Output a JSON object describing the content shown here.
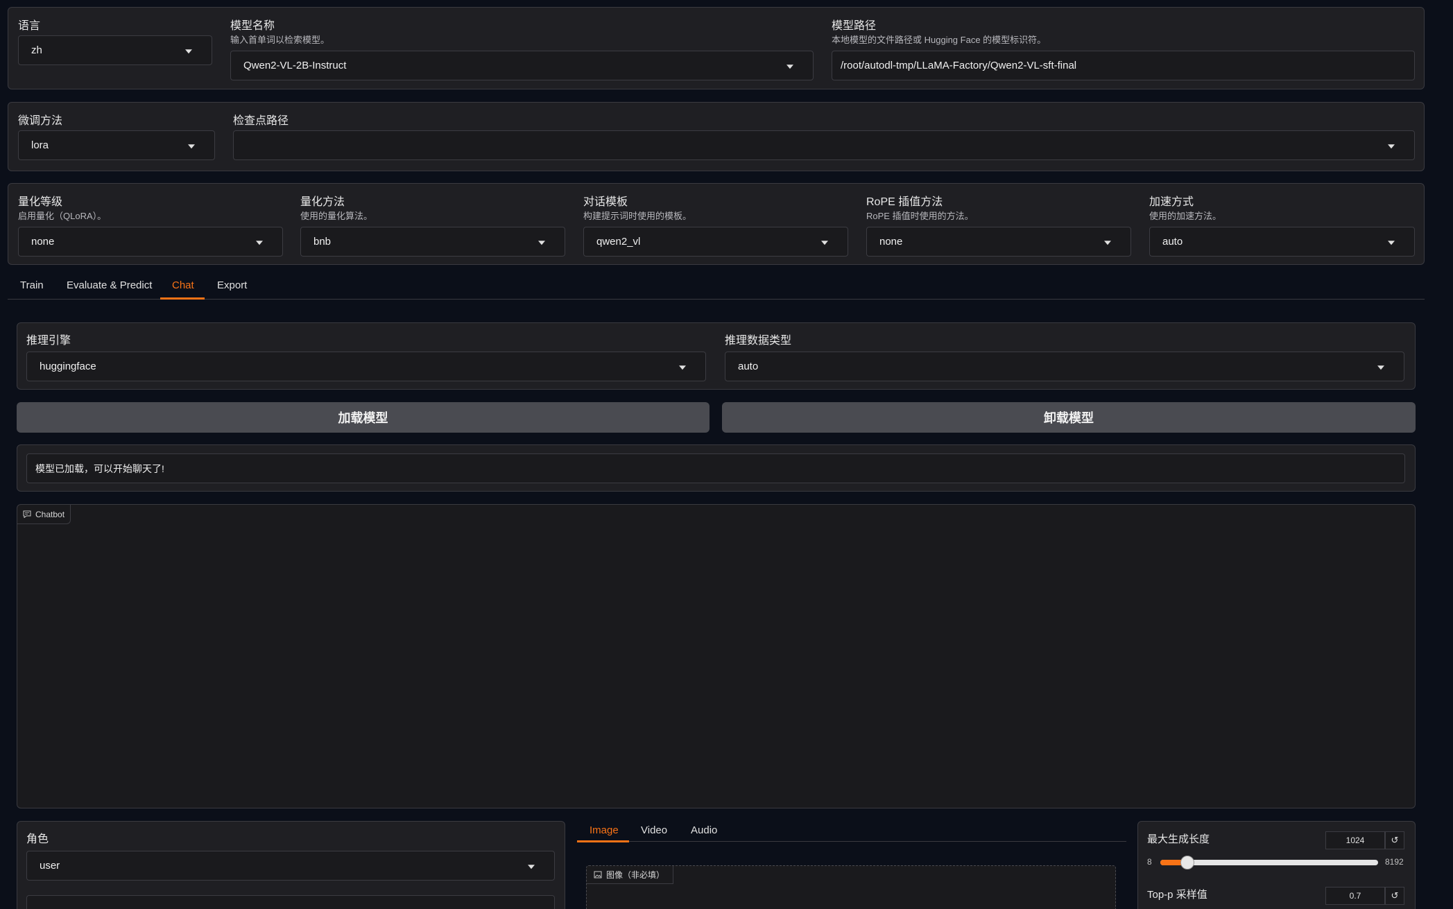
{
  "top_row": {
    "language": {
      "label": "语言",
      "value": "zh"
    },
    "model_name": {
      "label": "模型名称",
      "hint": "输入首单词以检索模型。",
      "value": "Qwen2-VL-2B-Instruct"
    },
    "model_path": {
      "label": "模型路径",
      "hint": "本地模型的文件路径或 Hugging Face 的模型标识符。",
      "value": "/root/autodl-tmp/LLaMA-Factory/Qwen2-VL-sft-final"
    }
  },
  "second_row": {
    "finetune": {
      "label": "微调方法",
      "value": "lora"
    },
    "checkpoint": {
      "label": "检查点路径",
      "value": ""
    }
  },
  "third_row": {
    "quant_bit": {
      "label": "量化等级",
      "hint": "启用量化（QLoRA）。",
      "value": "none"
    },
    "quant_method": {
      "label": "量化方法",
      "hint": "使用的量化算法。",
      "value": "bnb"
    },
    "template": {
      "label": "对话模板",
      "hint": "构建提示词时使用的模板。",
      "value": "qwen2_vl"
    },
    "rope": {
      "label": "RoPE 插值方法",
      "hint": "RoPE 插值时使用的方法。",
      "value": "none"
    },
    "booster": {
      "label": "加速方式",
      "hint": "使用的加速方法。",
      "value": "auto"
    }
  },
  "tabs": [
    "Train",
    "Evaluate & Predict",
    "Chat",
    "Export"
  ],
  "active_tab": "Chat",
  "chat": {
    "infer_backend": {
      "label": "推理引擎",
      "value": "huggingface"
    },
    "infer_dtype": {
      "label": "推理数据类型",
      "value": "auto"
    },
    "load_button": "加载模型",
    "unload_button": "卸载模型",
    "status": "模型已加载，可以开始聊天了!",
    "chatbot_label": "Chatbot",
    "role": {
      "label": "角色",
      "value": "user"
    },
    "media_tabs": [
      "Image",
      "Video",
      "Audio"
    ],
    "active_media_tab": "Image",
    "image_label": "图像（非必填）",
    "max_new_tokens": {
      "label": "最大生成长度",
      "value": "1024",
      "min": "8",
      "max": "8192",
      "fraction": 0.125
    },
    "top_p": {
      "label": "Top-p 采样值",
      "value": "0.7"
    }
  },
  "colors": {
    "accent": "#f97316",
    "panel": "#1f1f23",
    "background": "#0b0f19"
  }
}
